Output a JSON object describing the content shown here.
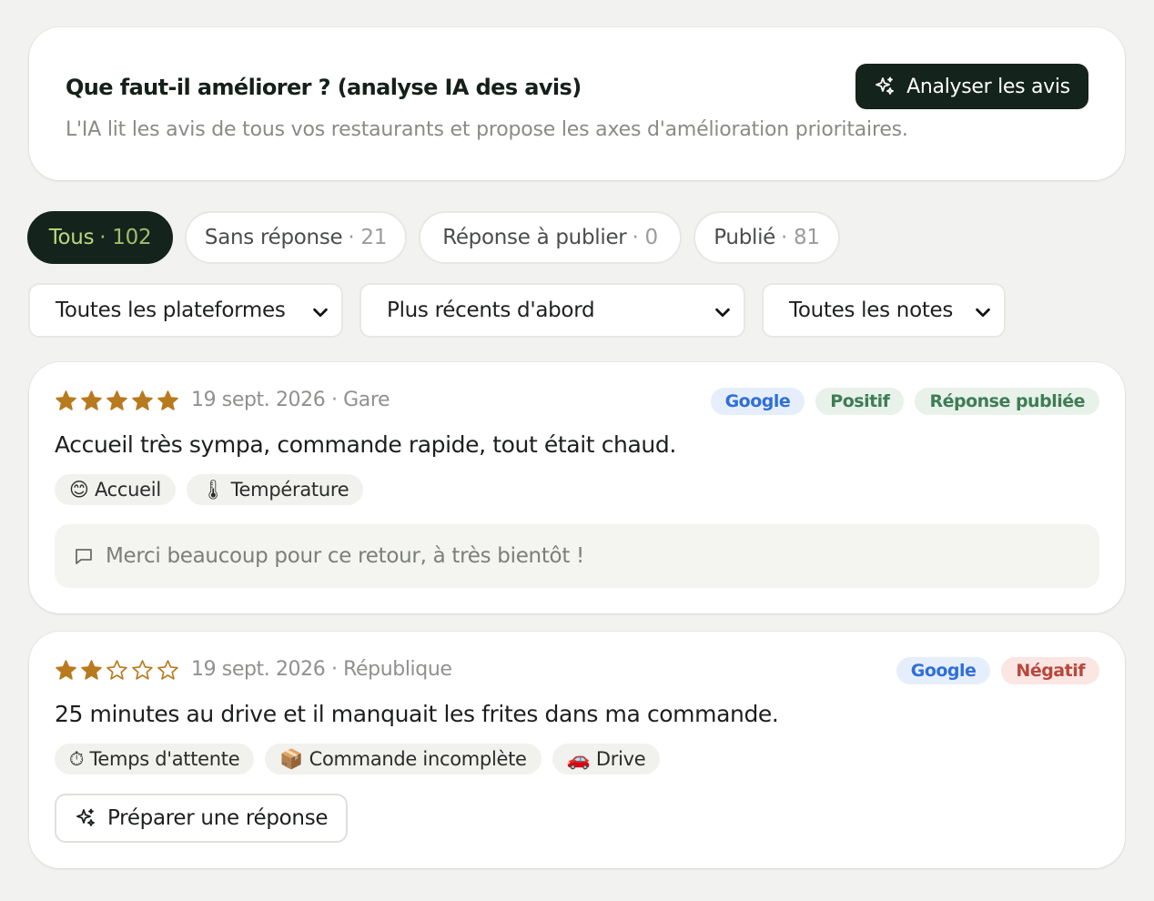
{
  "ai_card": {
    "title": "Que faut-il améliorer ? (analyse IA des avis)",
    "description": "L'IA lit les avis de tous vos restaurants et propose les axes d'amélioration prioritaires.",
    "analyze_label": "Analyser les avis"
  },
  "tabs": [
    {
      "label": "Tous",
      "count": "· 102",
      "active": true
    },
    {
      "label": "Sans réponse",
      "count": "· 21",
      "active": false
    },
    {
      "label": "Réponse à publier",
      "count": "· 0",
      "active": false
    },
    {
      "label": "Publié",
      "count": "· 81",
      "active": false
    }
  ],
  "filters": {
    "platform": "Toutes les plateformes",
    "sort": "Plus récents d'abord",
    "rating": "Toutes les notes"
  },
  "reviews": [
    {
      "rating": 5,
      "meta": "19 sept. 2026 · Gare",
      "badges": [
        "Google",
        "Positif",
        "Réponse publiée"
      ],
      "text": "Accueil très sympa, commande rapide, tout était chaud.",
      "tags": [
        "😊 Accueil",
        "🌡 Température"
      ],
      "reply": "Merci beaucoup pour ce retour, à très bientôt !"
    },
    {
      "rating": 2,
      "meta": "19 sept. 2026 · République",
      "badges": [
        "Google",
        "Négatif"
      ],
      "text": "25 minutes au drive et il manquait les frites dans ma commande.",
      "tags": [
        "⏱ Temps d'attente",
        "📦 Commande incomplète",
        "🚗 Drive"
      ],
      "prepare_label": "Préparer une réponse"
    }
  ],
  "colors": {
    "dark": "#14231c",
    "accent_green": "#b9d87b",
    "star": "#b87a1f",
    "google_blue": "#2f6fd8",
    "positive": "#3f7d55",
    "negative": "#b8473c"
  }
}
